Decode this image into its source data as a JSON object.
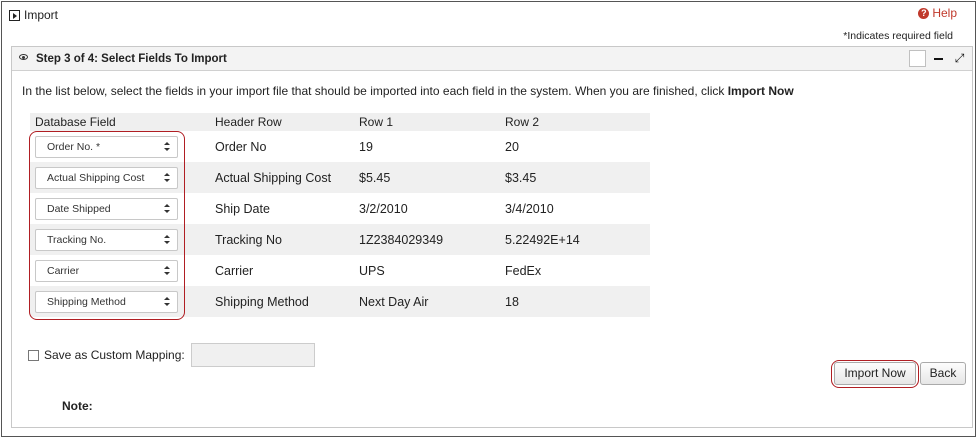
{
  "window": {
    "title": "Import",
    "help_label": "Help",
    "required_note": "*Indicates required field"
  },
  "panel": {
    "title": "Step 3 of 4: Select Fields To Import",
    "intro_text": "In the list below, select the fields in your import file that should be imported into each field in the system. When you are finished, click ",
    "intro_bold": "Import Now"
  },
  "table": {
    "headers": {
      "db": "Database Field",
      "header": "Header Row",
      "row1": "Row 1",
      "row2": "Row 2"
    },
    "rows": [
      {
        "db": "Order No. *",
        "header": "Order No",
        "row1": "19",
        "row2": "20"
      },
      {
        "db": "Actual Shipping Cost",
        "header": "Actual Shipping Cost",
        "row1": "$5.45",
        "row2": "$3.45"
      },
      {
        "db": "Date Shipped",
        "header": "Ship Date",
        "row1": "3/2/2010",
        "row2": "3/4/2010"
      },
      {
        "db": "Tracking No.",
        "header": "Tracking No",
        "row1": "1Z2384029349",
        "row2": "5.22492E+14"
      },
      {
        "db": "Carrier",
        "header": "Carrier",
        "row1": "UPS",
        "row2": "FedEx"
      },
      {
        "db": "Shipping Method",
        "header": "Shipping Method",
        "row1": "Next Day Air",
        "row2": "18"
      }
    ]
  },
  "custom_mapping": {
    "label": "Save as Custom Mapping:",
    "value": ""
  },
  "buttons": {
    "import_now": "Import Now",
    "back": "Back"
  },
  "note_label": "Note:",
  "colors": {
    "highlight": "#b01e23",
    "help": "#c0392b"
  }
}
